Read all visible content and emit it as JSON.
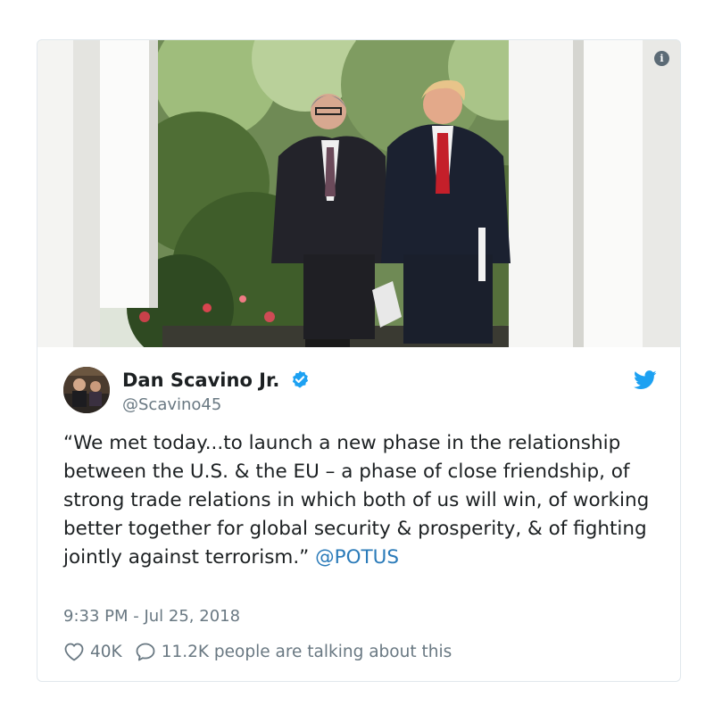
{
  "tweet": {
    "author_name": "Dan Scavino Jr.",
    "author_handle": "@Scavino45",
    "text": "“We met today...to launch a new phase in the relationship between the U.S. & the EU – a phase of close friendship, of strong trade relations in which both of us will win, of working better together for global security & prosperity, & of fighting jointly against terrorism.” ",
    "mention": "@POTUS",
    "timestamp": "9:33 PM - Jul 25, 2018",
    "likes": "40K",
    "conversation": "11.2K people are talking about this"
  },
  "icons": {
    "info": "info-icon",
    "verified": "verified-badge-icon",
    "twitter": "twitter-bird-icon",
    "like": "heart-icon",
    "reply": "speech-bubble-icon"
  },
  "colors": {
    "link": "#2b7bb9",
    "verified": "#1da1f2",
    "twitter_blue": "#1da1f2",
    "muted_text": "#697882",
    "border": "#e1e8ed"
  }
}
